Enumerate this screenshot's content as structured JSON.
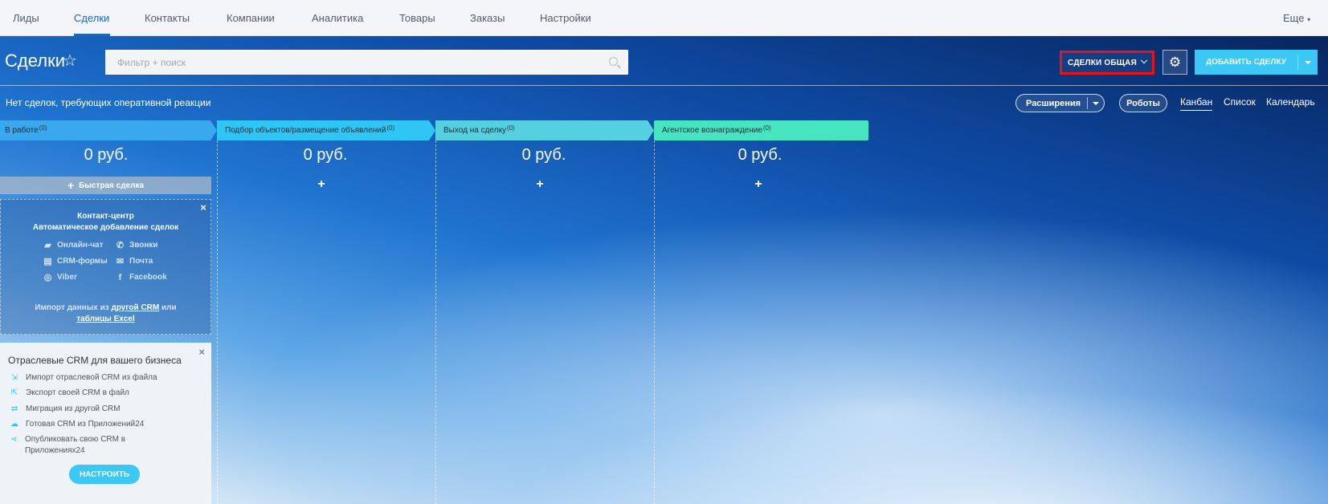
{
  "nav": {
    "items": [
      {
        "label": "Лиды"
      },
      {
        "label": "Сделки"
      },
      {
        "label": "Контакты"
      },
      {
        "label": "Компании"
      },
      {
        "label": "Аналитика"
      },
      {
        "label": "Товары"
      },
      {
        "label": "Заказы"
      },
      {
        "label": "Настройки"
      }
    ],
    "active": "Сделки",
    "more_label": "Еще"
  },
  "header": {
    "title": "Сделки",
    "search_placeholder": "Фильтр + поиск",
    "category_label": "СДЕЛКИ ОБЩАЯ",
    "add_label": "ДОБАВИТЬ СДЕЛКУ"
  },
  "toolbar": {
    "notice": "Нет сделок, требующих оперативной реакции",
    "extensions_label": "Расширения",
    "robots_label": "Роботы",
    "views": [
      {
        "label": "Канбан",
        "active": true
      },
      {
        "label": "Список",
        "active": false
      },
      {
        "label": "Календарь",
        "active": false
      }
    ]
  },
  "stages": [
    {
      "name": "В работе",
      "count": "(0)",
      "sum": "0 руб.",
      "color": "#39a8ef"
    },
    {
      "name": "Подбор объектов/размещение объявлений",
      "count": "(0)",
      "sum": "0 руб.",
      "color": "#2fc6f6"
    },
    {
      "name": "Выход на сделку",
      "count": "(0)",
      "sum": "0 руб.",
      "color": "#55d0e0"
    },
    {
      "name": "Агентское вознаграждение",
      "count": "(0)",
      "sum": "0 руб.",
      "color": "#47e4c2"
    }
  ],
  "add_plus": "+",
  "quick_deal_label": "Быстрая сделка",
  "contact_center": {
    "title_line1": "Контакт-центр",
    "title_line2": "Автоматическое добавление сделок",
    "channels": [
      {
        "label": "Онлайн-чат",
        "icon": "chat-icon"
      },
      {
        "label": "Звонки",
        "icon": "phone-icon"
      },
      {
        "label": "CRM-формы",
        "icon": "form-icon"
      },
      {
        "label": "Почта",
        "icon": "mail-icon"
      },
      {
        "label": "Viber",
        "icon": "viber-icon"
      },
      {
        "label": "Facebook",
        "icon": "facebook-icon"
      }
    ],
    "import_prefix": "Импорт данных из",
    "import_link1": "другой CRM",
    "import_mid": "или",
    "import_link2": "таблицы Excel"
  },
  "industry_crm": {
    "title": "Отраслевые CRM для вашего бизнеса",
    "items": [
      {
        "label": "Импорт отраслевой CRM из файла",
        "icon": "import-icon"
      },
      {
        "label": "Экспорт своей CRM в файл",
        "icon": "export-icon"
      },
      {
        "label": "Миграция из другой CRM",
        "icon": "migrate-icon"
      },
      {
        "label": "Готовая CRM из Приложений24",
        "icon": "cloud-icon"
      },
      {
        "label": "Опубликовать свою CRM в Приложениях24",
        "icon": "share-icon"
      }
    ],
    "setup_label": "НАСТРОИТЬ"
  },
  "close_symbol": "×",
  "colors": {
    "accent": "#2067b0",
    "button": "#3bc8f5",
    "highlight": "#e11111"
  }
}
